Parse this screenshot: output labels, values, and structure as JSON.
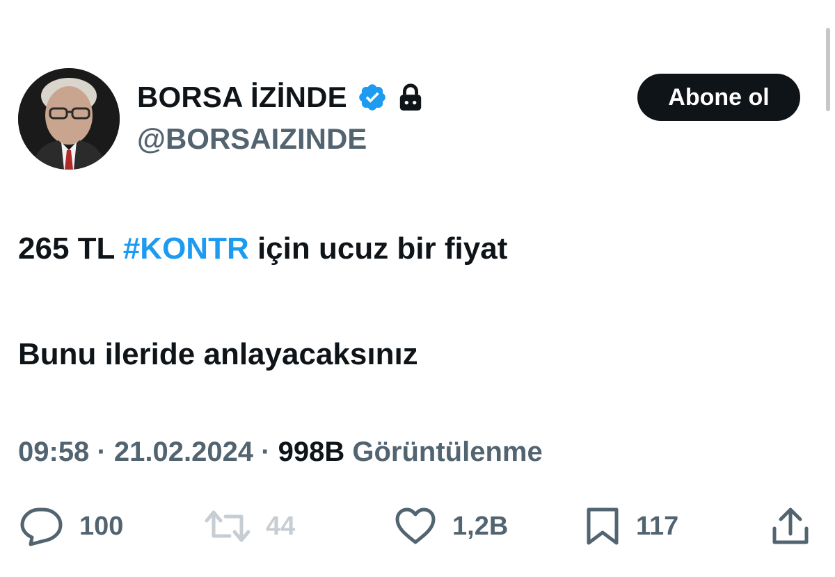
{
  "author": {
    "display_name": "BORSA İZİNDE",
    "handle": "@BORSAIZINDE",
    "verified": true,
    "protected": true,
    "avatar_icon": "avatar-photo"
  },
  "follow_button": {
    "label": "Abone ol"
  },
  "tweet": {
    "line1_prefix": "265 TL ",
    "line1_hashtag": "#KONTR",
    "line1_suffix": " için ucuz bir fiyat",
    "line2": "Bunu ileride anlayacaksınız"
  },
  "meta": {
    "time": "09:58",
    "separator": " · ",
    "date": "21.02.2024",
    "views_count": "998B",
    "views_label": " Görüntülenme"
  },
  "actions": {
    "replies": "100",
    "retweets": "44",
    "likes": "1,2B",
    "bookmarks": "117"
  },
  "colors": {
    "accent": "#1d9bf0",
    "text_primary": "#0f1419",
    "text_secondary": "#536471",
    "disabled": "#c6cdd3"
  }
}
